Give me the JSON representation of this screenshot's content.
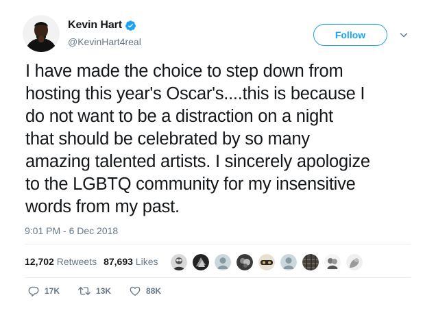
{
  "author": {
    "display_name": "Kevin Hart",
    "handle": "@KevinHart4real",
    "verified": true
  },
  "header": {
    "follow_label": "Follow"
  },
  "tweet": {
    "text": "I have made the choice to step down from\nhosting this year's Oscar's....this is because I\ndo not want to be a distraction on a night\nthat should be celebrated by so many\namazing talented artists. I sincerely apologize\nto the LGBTQ community for my insensitive\nwords from my past.",
    "timestamp": "9:01 PM - 6 Dec 2018"
  },
  "stats": {
    "retweets_count": "12,702",
    "retweets_label": "Retweets",
    "likes_count": "87,693",
    "likes_label": "Likes"
  },
  "liked_by_avatars": [
    "liker-avatar",
    "liker-avatar",
    "liker-avatar",
    "liker-avatar",
    "liker-avatar",
    "liker-avatar",
    "liker-avatar",
    "liker-avatar",
    "liker-avatar"
  ],
  "actions": {
    "replies": "17K",
    "retweets": "13K",
    "likes": "88K"
  },
  "colors": {
    "brand_blue": "#1da1f2",
    "text_primary": "#14171a",
    "text_secondary": "#657786",
    "divider": "#e6ecf0"
  }
}
